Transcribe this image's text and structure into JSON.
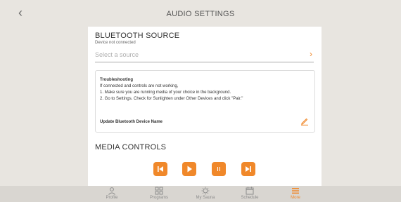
{
  "header": {
    "title": "AUDIO SETTINGS",
    "back_icon": "chevron-left-icon"
  },
  "bluetooth": {
    "title": "BLUETOOTH SOURCE",
    "status": "Device not connected",
    "source_placeholder": "Select a source"
  },
  "troubleshooting": {
    "heading": "Troubleshooting",
    "lines": [
      "If connected and controls are not working,",
      "1. Make sure you are running media of your choice in the background.",
      "2. Go to Settings. Check for Sunlighten under Other Devices and click \"Pair.\""
    ],
    "update_label": "Update Bluetooth Device Name"
  },
  "media": {
    "title": "MEDIA CONTROLS",
    "controls": [
      "previous-icon",
      "play-icon",
      "pause-icon",
      "next-icon"
    ]
  },
  "tabs": [
    {
      "label": "Profile",
      "icon": "profile-icon",
      "active": false
    },
    {
      "label": "Programs",
      "icon": "programs-icon",
      "active": false
    },
    {
      "label": "My Sauna",
      "icon": "sauna-icon",
      "active": false
    },
    {
      "label": "Schedule",
      "icon": "calendar-icon",
      "active": false
    },
    {
      "label": "More",
      "icon": "menu-icon",
      "active": true
    }
  ],
  "colors": {
    "accent": "#f0882a",
    "background": "#e8e5e0",
    "card": "#ffffff"
  }
}
